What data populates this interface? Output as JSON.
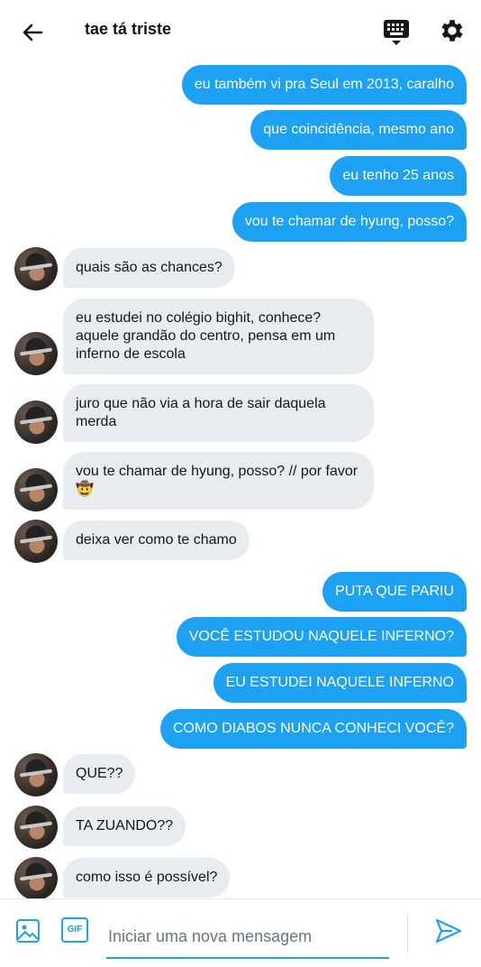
{
  "header": {
    "title": "tae tá triste"
  },
  "messages": [
    {
      "dir": "out",
      "text": "eu também vi pra Seul em 2013, caralho"
    },
    {
      "dir": "out",
      "text": "que coincidência, mesmo ano"
    },
    {
      "dir": "out",
      "text": "eu tenho 25 anos"
    },
    {
      "dir": "out",
      "text": "vou te chamar de hyung, posso?"
    },
    {
      "dir": "in",
      "text": "quais são as chances?"
    },
    {
      "dir": "in",
      "text": "eu estudei no colégio bighit, conhece?\naquele grandão do centro, pensa em um\ninferno de escola"
    },
    {
      "dir": "in",
      "text": "juro que não via a hora de sair daquela\nmerda"
    },
    {
      "dir": "in",
      "text": "vou te chamar de hyung, posso? // por favor\n🤠"
    },
    {
      "dir": "in",
      "text": "deixa ver como te chamo"
    },
    {
      "dir": "out",
      "text": "PUTA QUE PARIU"
    },
    {
      "dir": "out",
      "text": "VOCÊ ESTUDOU NAQUELE INFERNO?"
    },
    {
      "dir": "out",
      "text": "EU ESTUDEI NAQUELE INFERNO"
    },
    {
      "dir": "out",
      "text": "COMO DIABOS NUNCA CONHECI VOCÊ?"
    },
    {
      "dir": "in",
      "text": "QUE??"
    },
    {
      "dir": "in",
      "text": "TA ZUANDO??"
    },
    {
      "dir": "in",
      "text": "como isso é possível?"
    }
  ],
  "composer": {
    "placeholder": "Iniciar uma nova mensagem",
    "gif_label": "GIF"
  },
  "icons": {
    "back": "arrow-left-icon",
    "keyboard": "keyboard-icon",
    "settings": "gear-icon",
    "image": "image-icon",
    "gif": "gif-icon",
    "send": "send-icon"
  },
  "colors": {
    "accent": "#1da1f2",
    "incoming_bubble": "#e6ecf0",
    "text": "#14171a"
  }
}
